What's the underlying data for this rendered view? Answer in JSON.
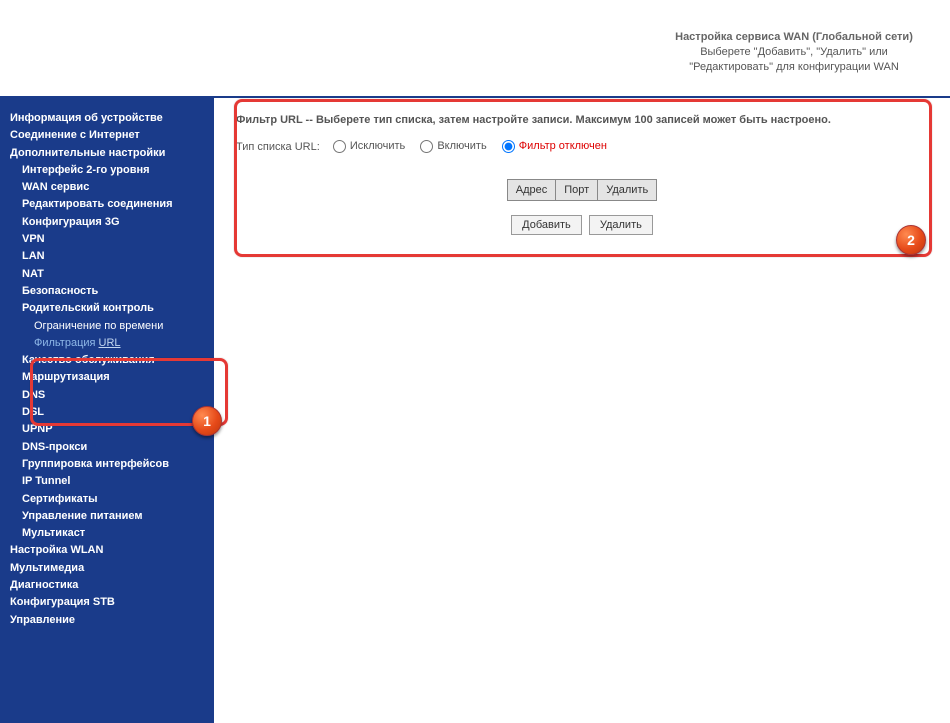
{
  "header": {
    "title": "Настройка сервиса WAN (Глобальной сети)",
    "subtitle": "Выберете \"Добавить\", \"Удалить\" или \"Редактировать\" для конфигурации WAN"
  },
  "nav": {
    "deviceInfo": "Информация об устройстве",
    "internetConn": "Соединение с Интернет",
    "advanced": "Дополнительные настройки",
    "l2iface": "Интерфейс 2-го уровня",
    "wanService": "WAN сервис",
    "editConn": "Редактировать соединения",
    "cfg3g": "Конфигурация 3G",
    "vpn": "VPN",
    "lan": "LAN",
    "nat": "NAT",
    "security": "Безопасность",
    "parental": "Родительский контроль",
    "timeRestrict": "Ограничение по времени",
    "urlFilterPre": "Фильтрация ",
    "urlFilterU": "URL",
    "qos": "Качество обслуживания",
    "routing": "Маршрутизация",
    "dns": "DNS",
    "dsl": "DSL",
    "upnp": "UPNP",
    "dnsProxy": "DNS-прокси",
    "ifGroup": "Группировка интерфейсов",
    "ipTunnel": "IP Tunnel",
    "certs": "Сертификаты",
    "power": "Управление питанием",
    "multicast": "Мультикаст",
    "wlan": "Настройка WLAN",
    "multimedia": "Мультимедиа",
    "diag": "Диагностика",
    "stb": "Конфигурация STB",
    "manage": "Управление"
  },
  "main": {
    "title": "Фильтр URL -- Выберете тип списка, затем настройте записи. Максимум 100 записей может быть настроено.",
    "listTypeLabel": "Тип списка URL:",
    "optExclude": "Исключить",
    "optInclude": "Включить",
    "optDisabled": "Фильтр отключен",
    "colAddr": "Адрес",
    "colPort": "Порт",
    "colDel": "Удалить",
    "btnAdd": "Добавить",
    "btnDel": "Удалить"
  },
  "marks": {
    "n1": "1",
    "n2": "2"
  }
}
